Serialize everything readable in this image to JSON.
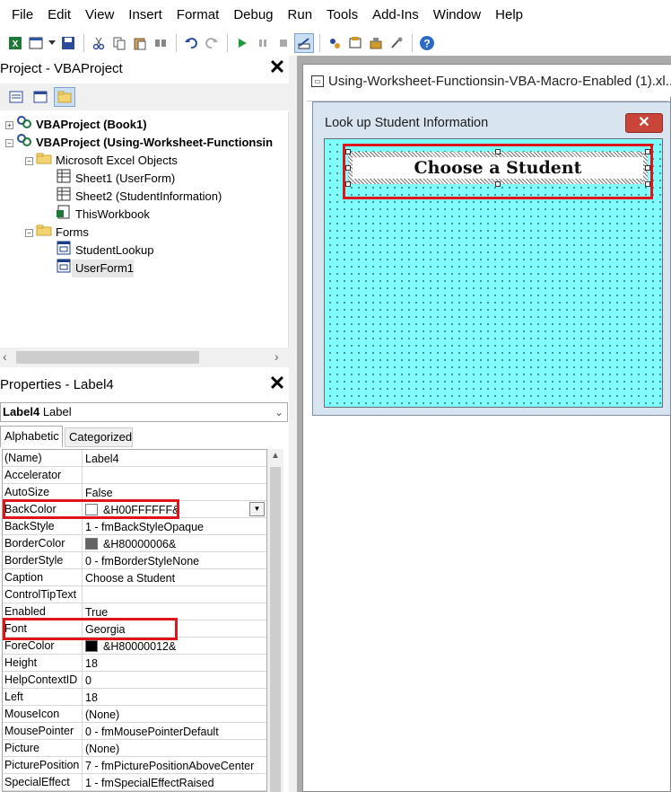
{
  "menu": [
    "File",
    "Edit",
    "View",
    "Insert",
    "Format",
    "Debug",
    "Run",
    "Tools",
    "Add-Ins",
    "Window",
    "Help"
  ],
  "toolbar_icons": [
    "excel-view-icon",
    "insert-userform-icon",
    "dropdown-arrow-icon",
    "save-icon",
    "cut-icon",
    "copy-icon",
    "paste-icon",
    "find-icon",
    "undo-icon",
    "redo-icon",
    "run-icon",
    "break-icon",
    "reset-icon",
    "design-mode-icon",
    "project-explorer-icon",
    "properties-window-icon",
    "object-browser-icon",
    "toolbox-icon",
    "help-icon"
  ],
  "project": {
    "title": "Project - VBAProject",
    "tree": [
      {
        "label": "VBAProject (Book1)",
        "bold": true,
        "expander": "+",
        "icon": "vbaproject-icon"
      },
      {
        "label": "VBAProject (Using-Worksheet-Functionsin",
        "bold": true,
        "expander": "−",
        "icon": "vbaproject-icon"
      },
      {
        "label": "Microsoft Excel Objects",
        "bold": false,
        "expander": "−",
        "icon": "folder-icon"
      },
      {
        "label": "Sheet1 (UserForm)",
        "bold": false,
        "icon": "sheet-icon"
      },
      {
        "label": "Sheet2 (StudentInformation)",
        "bold": false,
        "icon": "sheet-icon"
      },
      {
        "label": "ThisWorkbook",
        "bold": false,
        "icon": "workbook-icon"
      },
      {
        "label": "Forms",
        "bold": false,
        "expander": "−",
        "icon": "folder-icon"
      },
      {
        "label": "StudentLookup",
        "bold": false,
        "icon": "form-icon"
      },
      {
        "label": "UserForm1",
        "bold": false,
        "icon": "form-icon",
        "selected": true
      }
    ]
  },
  "properties": {
    "title": "Properties - Label4",
    "object_name": "Label4",
    "object_type": "Label",
    "tabs": [
      "Alphabetic",
      "Categorized"
    ],
    "rows": [
      {
        "name": "(Name)",
        "value": "Label4"
      },
      {
        "name": "Accelerator",
        "value": ""
      },
      {
        "name": "AutoSize",
        "value": "False"
      },
      {
        "name": "BackColor",
        "value": "&H00FFFFFF&",
        "swatch": "#ffffff",
        "dropdown": true
      },
      {
        "name": "BackStyle",
        "value": "1 - fmBackStyleOpaque"
      },
      {
        "name": "BorderColor",
        "value": "&H80000006&",
        "swatch": "#646464"
      },
      {
        "name": "BorderStyle",
        "value": "0 - fmBorderStyleNone"
      },
      {
        "name": "Caption",
        "value": "Choose a Student"
      },
      {
        "name": "ControlTipText",
        "value": ""
      },
      {
        "name": "Enabled",
        "value": "True"
      },
      {
        "name": "Font",
        "value": "Georgia"
      },
      {
        "name": "ForeColor",
        "value": "&H80000012&",
        "swatch": "#000000"
      },
      {
        "name": "Height",
        "value": "18"
      },
      {
        "name": "HelpContextID",
        "value": "0"
      },
      {
        "name": "Left",
        "value": "18"
      },
      {
        "name": "MouseIcon",
        "value": "(None)"
      },
      {
        "name": "MousePointer",
        "value": "0 - fmMousePointerDefault"
      },
      {
        "name": "Picture",
        "value": "(None)"
      },
      {
        "name": "PicturePosition",
        "value": "7 - fmPicturePositionAboveCenter"
      },
      {
        "name": "SpecialEffect",
        "value": "1 - fmSpecialEffectRaised"
      }
    ]
  },
  "designer": {
    "window_title": "Using-Worksheet-Functionsin-VBA-Macro-Enabled (1).xl...",
    "form_caption": "Look up Student Information",
    "label_caption": "Choose a Student",
    "canvas_color": "#7fffff"
  },
  "highlight_color": "#e0141b"
}
